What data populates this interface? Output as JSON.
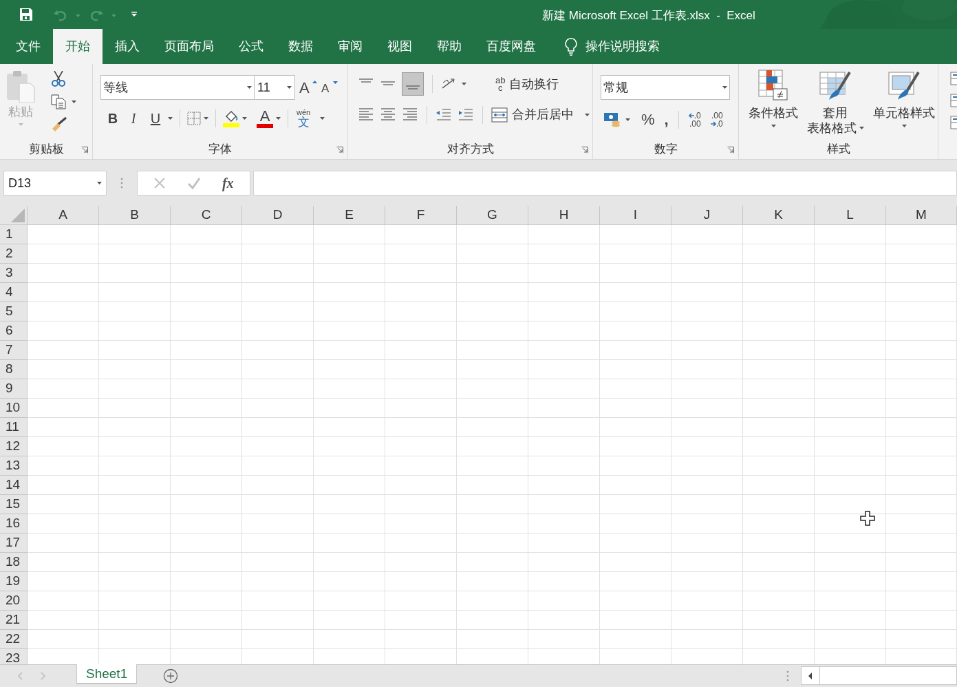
{
  "window": {
    "title": "新建 Microsoft Excel 工作表.xlsx  -  Excel"
  },
  "tabs": [
    {
      "label": "文件",
      "selected": false
    },
    {
      "label": "开始",
      "selected": true
    },
    {
      "label": "插入",
      "selected": false
    },
    {
      "label": "页面布局",
      "selected": false
    },
    {
      "label": "公式",
      "selected": false
    },
    {
      "label": "数据",
      "selected": false
    },
    {
      "label": "审阅",
      "selected": false
    },
    {
      "label": "视图",
      "selected": false
    },
    {
      "label": "帮助",
      "selected": false
    },
    {
      "label": "百度网盘",
      "selected": false
    }
  ],
  "tell_me": {
    "label": "操作说明搜索"
  },
  "ribbon": {
    "clipboard": {
      "paste": "粘贴",
      "label": "剪贴板"
    },
    "font": {
      "name": "等线",
      "size": "11",
      "grow": "A",
      "shrink": "A",
      "bold": "B",
      "italic": "I",
      "underline": "U",
      "font_color": "A",
      "phonetic": "wén",
      "phonetic_char": "文",
      "label": "字体"
    },
    "alignment": {
      "wrap_icon_top": "ab",
      "wrap_icon_bottom": "c",
      "wrap_text": "自动换行",
      "merge": "合并后居中",
      "label": "对齐方式"
    },
    "number": {
      "format": "常规",
      "percent": "%",
      "comma": ",",
      "increase_decimal": [
        ".0",
        ".00"
      ],
      "decrease_decimal": [
        ".00",
        ".0"
      ],
      "label": "数字"
    },
    "styles": {
      "conditional": "条件格式",
      "table_top": "套用",
      "table_bottom": "表格格式",
      "cell": "单元格样式",
      "label": "样式"
    }
  },
  "formula_bar": {
    "name_box": "D13",
    "fx": "fx"
  },
  "sheet": {
    "columns": [
      "A",
      "B",
      "C",
      "D",
      "E",
      "F",
      "G",
      "H",
      "I",
      "J",
      "K",
      "L",
      "M"
    ],
    "rows": [
      "1",
      "2",
      "3",
      "4",
      "5",
      "6",
      "7",
      "8",
      "9",
      "10",
      "11",
      "12",
      "13",
      "14",
      "15",
      "16",
      "17",
      "18",
      "19",
      "20",
      "21",
      "22",
      "23"
    ]
  },
  "sheet_tabs": [
    {
      "label": "Sheet1",
      "selected": true
    }
  ]
}
